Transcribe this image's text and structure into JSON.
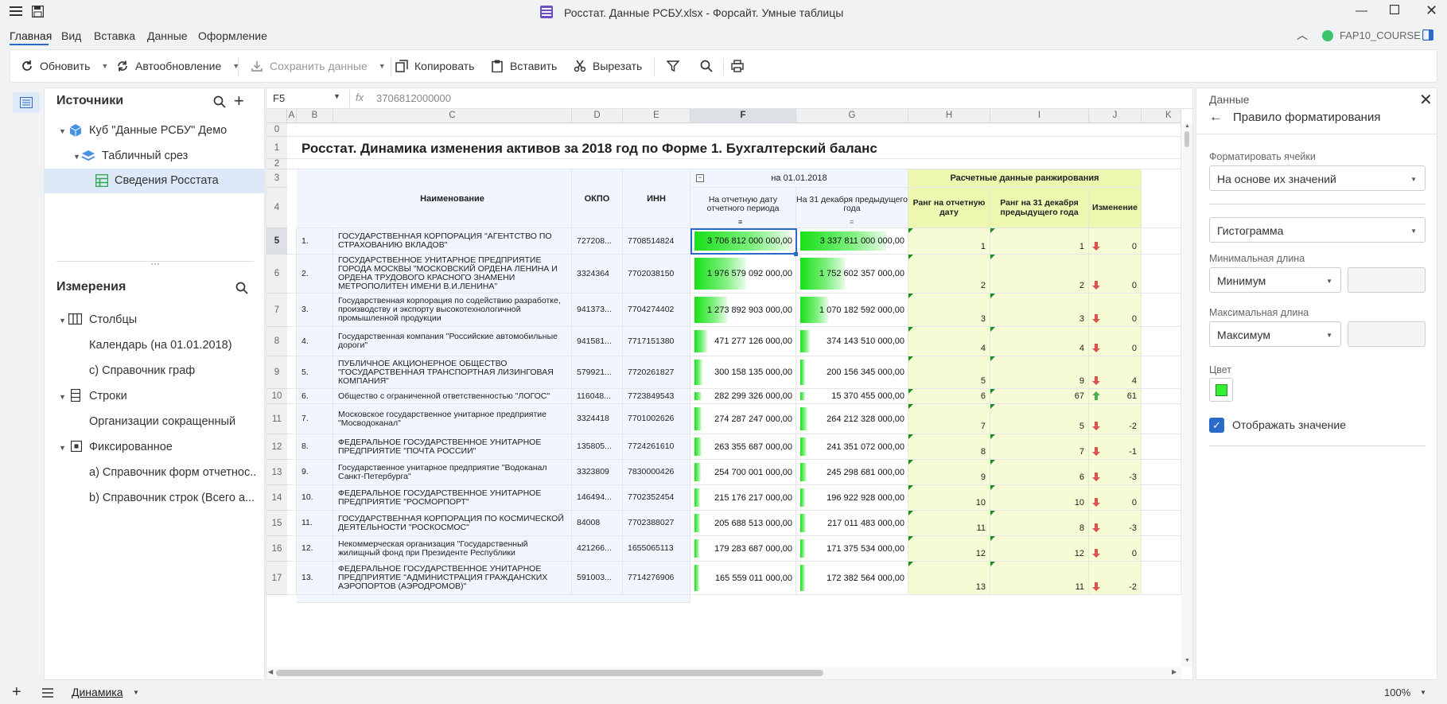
{
  "window": {
    "title": "Росстат. Данные РСБУ.xlsx - Форсайт. Умные таблицы"
  },
  "menu": [
    "Главная",
    "Вид",
    "Вставка",
    "Данные",
    "Оформление"
  ],
  "user": "FAP10_COURSE",
  "toolbar": {
    "refresh": "Обновить",
    "autorefresh": "Автообновление",
    "save": "Сохранить данные",
    "copy": "Копировать",
    "paste": "Вставить",
    "cut": "Вырезать"
  },
  "sources": {
    "title": "Источники",
    "cube": "Куб \"Данные РСБУ\" Демо",
    "slice": "Табличный срез",
    "sheet": "Сведения Росстата"
  },
  "dimensions": {
    "title": "Измерения",
    "columns": "Столбцы",
    "col_items": [
      "Календарь (на 01.01.2018)",
      "c) Справочник граф"
    ],
    "rows": "Строки",
    "row_items": [
      "Организации сокращенный"
    ],
    "fixed": "Фиксированное",
    "fixed_items": [
      "a) Справочник форм отчетнос...",
      "b) Справочник строк (Всего а..."
    ]
  },
  "formula": {
    "cellref": "F5",
    "fx": "fx",
    "value": "3706812000000"
  },
  "colletters": [
    "A",
    "B",
    "C",
    "D",
    "E",
    "F",
    "G",
    "H",
    "I",
    "J",
    "K"
  ],
  "sheet": {
    "title": "Росстат. Динамика изменения активов за 2018 год по Форме 1. Бухгалтерский баланс",
    "group1": "на 01.01.2018",
    "group2": "Расчетные данные ранжирования",
    "h_name": "Наименование",
    "h_okpo": "ОКПО",
    "h_inn": "ИНН",
    "h_f": "На отчетную дату отчетного периода",
    "h_g": "На 31 декабря предыдущего года",
    "h_h": "Ранг на отчетную дату",
    "h_i": "Ранг на 31 декабря предыдущего года",
    "h_j": "Изменение",
    "rows": [
      {
        "n": "1.",
        "name": "ГОСУДАРСТВЕННАЯ КОРПОРАЦИЯ \"АГЕНТСТВО ПО СТРАХОВАНИЮ ВКЛАДОВ\"",
        "okpo": "727208...",
        "inn": "7708514824",
        "f": "3 706 812 000 000,00",
        "g": "3 337 811 000 000,00",
        "fv": 1.0,
        "gv": 0.9,
        "h": "1",
        "i": "1",
        "dir": "down",
        "j": "0"
      },
      {
        "n": "2.",
        "name": "ГОСУДАРСТВЕННОЕ УНИТАРНОЕ ПРЕДПРИЯТИЕ ГОРОДА МОСКВЫ \"МОСКОВСКИЙ ОРДЕНА ЛЕНИНА И ОРДЕНА ТРУДОВОГО КРАСНОГО ЗНАМЕНИ МЕТРОПОЛИТЕН ИМЕНИ В.И.ЛЕНИНА\"",
        "okpo": "3324364",
        "inn": "7702038150",
        "f": "1 976 579 092 000,00",
        "g": "1 752 602 357 000,00",
        "fv": 0.53,
        "gv": 0.47,
        "h": "2",
        "i": "2",
        "dir": "down",
        "j": "0"
      },
      {
        "n": "3.",
        "name": "Государственная корпорация по содействию разработке, производству и экспорту высокотехнологичной промышленной продукции",
        "okpo": "941373...",
        "inn": "7704274402",
        "f": "1 273 892 903 000,00",
        "g": "1 070 182 592 000,00",
        "fv": 0.34,
        "gv": 0.29,
        "h": "3",
        "i": "3",
        "dir": "down",
        "j": "0"
      },
      {
        "n": "4.",
        "name": "Государственная компания \"Российские автомобильные дороги\"",
        "okpo": "941581...",
        "inn": "7717151380",
        "f": "471 277 126 000,00",
        "g": "374 143 510 000,00",
        "fv": 0.13,
        "gv": 0.1,
        "h": "4",
        "i": "4",
        "dir": "down",
        "j": "0"
      },
      {
        "n": "5.",
        "name": "ПУБЛИЧНОЕ АКЦИОНЕРНОЕ ОБЩЕСТВО \"ГОСУДАРСТВЕННАЯ ТРАНСПОРТНАЯ ЛИЗИНГОВАЯ КОМПАНИЯ\"",
        "okpo": "579921...",
        "inn": "7720261827",
        "f": "300 158 135 000,00",
        "g": "200 156 345 000,00",
        "fv": 0.08,
        "gv": 0.054,
        "h": "5",
        "i": "9",
        "dir": "down",
        "j": "4"
      },
      {
        "n": "6.",
        "name": "Общество с ограниченной ответственностью \"ЛОГОС\"",
        "okpo": "116048...",
        "inn": "7723849543",
        "f": "282 299 326 000,00",
        "g": "15 370 455 000,00",
        "fv": 0.076,
        "gv": 0.004,
        "h": "6",
        "i": "67",
        "dir": "up",
        "j": "61"
      },
      {
        "n": "7.",
        "name": "Московское государственное унитарное предприятие \"Мосводоканал\"",
        "okpo": "3324418",
        "inn": "7701002626",
        "f": "274 287 247 000,00",
        "g": "264 212 328 000,00",
        "fv": 0.074,
        "gv": 0.071,
        "h": "7",
        "i": "5",
        "dir": "down",
        "j": "-2"
      },
      {
        "n": "8.",
        "name": "ФЕДЕРАЛЬНОЕ ГОСУДАРСТВЕННОЕ УНИТАРНОЕ ПРЕДПРИЯТИЕ \"ПОЧТА РОССИИ\"",
        "okpo": "135805...",
        "inn": "7724261610",
        "f": "263 355 687 000,00",
        "g": "241 351 072 000,00",
        "fv": 0.071,
        "gv": 0.065,
        "h": "8",
        "i": "7",
        "dir": "down",
        "j": "-1"
      },
      {
        "n": "9.",
        "name": "Государственное унитарное предприятие \"Водоканал Санкт-Петербурга\"",
        "okpo": "3323809",
        "inn": "7830000426",
        "f": "254 700 001 000,00",
        "g": "245 298 681 000,00",
        "fv": 0.069,
        "gv": 0.066,
        "h": "9",
        "i": "6",
        "dir": "down",
        "j": "-3"
      },
      {
        "n": "10.",
        "name": "ФЕДЕРАЛЬНОЕ ГОСУДАРСТВЕННОЕ УНИТАРНОЕ ПРЕДПРИЯТИЕ \"РОСМОРПОРТ\"",
        "okpo": "146494...",
        "inn": "7702352454",
        "f": "215 176 217 000,00",
        "g": "196 922 928 000,00",
        "fv": 0.058,
        "gv": 0.053,
        "h": "10",
        "i": "10",
        "dir": "down",
        "j": "0"
      },
      {
        "n": "11.",
        "name": "ГОСУДАРСТВЕННАЯ КОРПОРАЦИЯ ПО КОСМИЧЕСКОЙ ДЕЯТЕЛЬНОСТИ \"РОСКОСМОС\"",
        "okpo": "84008",
        "inn": "7702388027",
        "f": "205 688 513 000,00",
        "g": "217 011 483 000,00",
        "fv": 0.055,
        "gv": 0.058,
        "h": "11",
        "i": "8",
        "dir": "down",
        "j": "-3"
      },
      {
        "n": "12.",
        "name": "Некоммерческая организация \"Государственный жилищный фонд при Президенте Республики",
        "okpo": "421266...",
        "inn": "1655065113",
        "f": "179 283 687 000,00",
        "g": "171 375 534 000,00",
        "fv": 0.048,
        "gv": 0.046,
        "h": "12",
        "i": "12",
        "dir": "down",
        "j": "0"
      },
      {
        "n": "13.",
        "name": "ФЕДЕРАЛЬНОЕ ГОСУДАРСТВЕННОЕ УНИТАРНОЕ ПРЕДПРИЯТИЕ \"АДМИНИСТРАЦИЯ ГРАЖДАНСКИХ АЭРОПОРТОВ (АЭРОДРОМОВ)\"",
        "okpo": "591003...",
        "inn": "7714276906",
        "f": "165 559 011 000,00",
        "g": "172 382 564 000,00",
        "fv": 0.045,
        "gv": 0.046,
        "h": "13",
        "i": "11",
        "dir": "down",
        "j": "-2"
      }
    ],
    "row_numbers": [
      "5",
      "6",
      "7",
      "8",
      "9",
      "10",
      "11",
      "12",
      "13",
      "14",
      "15",
      "16",
      "17"
    ]
  },
  "panel": {
    "section": "Данные",
    "title": "Правило форматирования",
    "format_label": "Форматировать ячейки",
    "format_value": "На основе их значений",
    "style_value": "Гистограмма",
    "min_label": "Минимальная длина",
    "min_value": "Минимум",
    "max_label": "Максимальная длина",
    "max_value": "Максимум",
    "color_label": "Цвет",
    "color": "#33ee33",
    "show_value": "Отображать значение"
  },
  "status": {
    "tab": "Динамика",
    "zoom": "100%"
  },
  "colors": {
    "accent": "#2a6ac8",
    "bar": "#18e018",
    "up": "#4caf50",
    "down": "#d9534f"
  }
}
